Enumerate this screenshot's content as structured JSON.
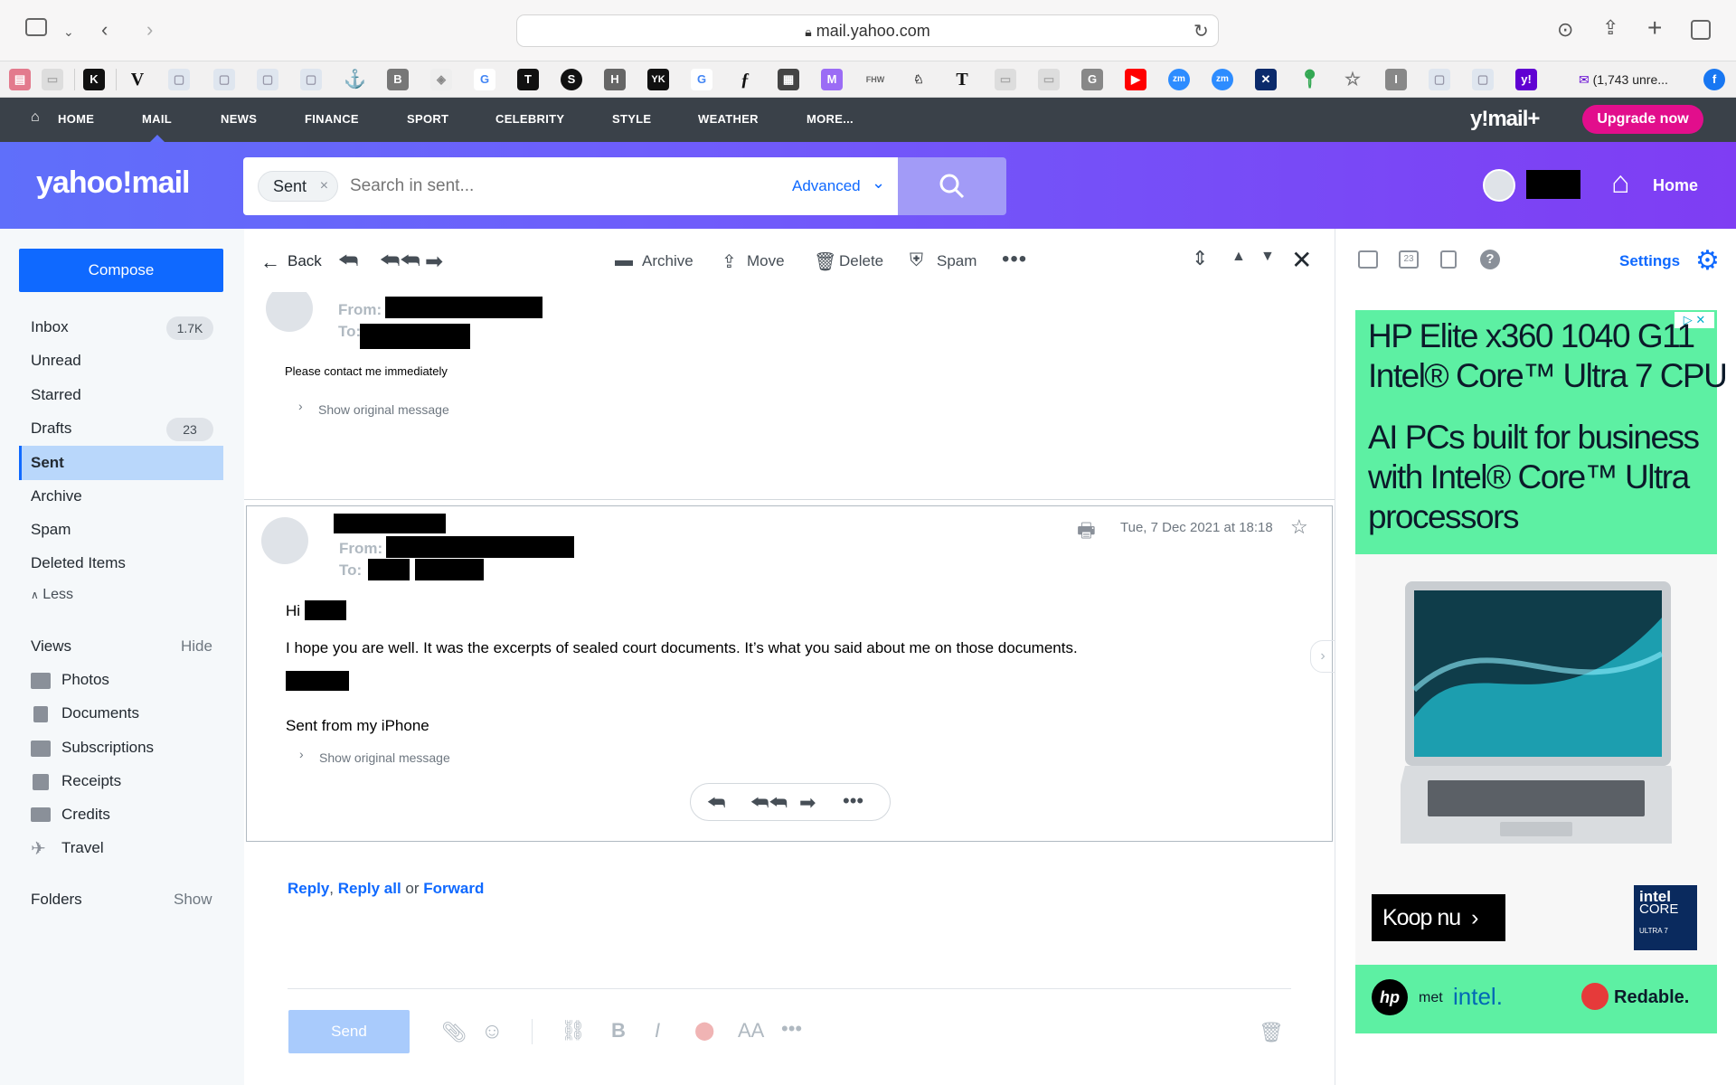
{
  "browser": {
    "url": "mail.yahoo.com",
    "bookmark_tab": "(1,743 unre..."
  },
  "ynav": {
    "items": [
      "HOME",
      "MAIL",
      "NEWS",
      "FINANCE",
      "SPORT",
      "CELEBRITY",
      "STYLE",
      "WEATHER",
      "MORE..."
    ],
    "brand": "y!mail+",
    "upgrade": "Upgrade now"
  },
  "header": {
    "logo": "yahoo!mail",
    "search_chip": "Sent",
    "search_placeholder": "Search in sent...",
    "advanced": "Advanced",
    "home": "Home"
  },
  "sidebar": {
    "compose": "Compose",
    "folders": [
      {
        "label": "Inbox",
        "count": "1.7K"
      },
      {
        "label": "Unread",
        "count": ""
      },
      {
        "label": "Starred",
        "count": ""
      },
      {
        "label": "Drafts",
        "count": "23"
      },
      {
        "label": "Sent",
        "count": ""
      },
      {
        "label": "Archive",
        "count": ""
      },
      {
        "label": "Spam",
        "count": ""
      },
      {
        "label": "Deleted Items",
        "count": ""
      }
    ],
    "less": "Less",
    "views_label": "Views",
    "views_toggle": "Hide",
    "views": [
      "Photos",
      "Documents",
      "Subscriptions",
      "Receipts",
      "Credits",
      "Travel"
    ],
    "folders_label": "Folders",
    "folders_toggle": "Show"
  },
  "toolbar": {
    "back": "Back",
    "archive": "Archive",
    "move": "Move",
    "delete": "Delete",
    "spam": "Spam"
  },
  "message1": {
    "from_label": "From:",
    "to_label": "To:",
    "body": "Please contact me immediately",
    "show_original": "Show original message"
  },
  "message2": {
    "date": "Tue, 7 Dec 2021 at 18:18",
    "from_label": "From:",
    "to_label": "To:",
    "greeting": "Hi",
    "body": "I hope you are well. It was the excerpts of sealed court documents. It’s what you said about me on those documents.",
    "signature": "Sent from my iPhone",
    "show_original": "Show original message"
  },
  "reply_bar": {
    "reply": "Reply",
    "reply_all": "Reply all",
    "or": "or",
    "forward": "Forward",
    "send": "Send"
  },
  "right": {
    "settings": "Settings",
    "calendar_day": "23"
  },
  "ad": {
    "title1": "HP Elite x360 1040 G11",
    "title2": "Intel® Core™ Ultra 7 CPU",
    "body1": "AI PCs built for business",
    "body2": "with Intel® Core™ Ultra",
    "body3": "processors",
    "cta": "Koop nu",
    "chip_line1": "intel",
    "chip_line2": "CORE",
    "chip_line3": "ULTRA 7",
    "foot_met": "met",
    "foot_intel": "intel.",
    "foot_redable": "Redable."
  }
}
